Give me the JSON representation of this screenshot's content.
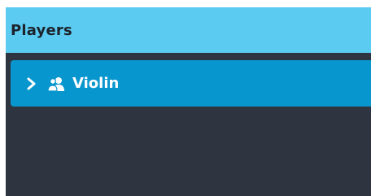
{
  "panel": {
    "title": "Players"
  },
  "players": [
    {
      "name": "Violin",
      "expand_icon": "chevron-right-icon",
      "type_icon": "people-icon"
    }
  ],
  "colors": {
    "header_bg": "#5ccbf2",
    "panel_bg": "#2f3540",
    "row_selected_bg": "#0896cf",
    "row_text": "#ffffff"
  }
}
